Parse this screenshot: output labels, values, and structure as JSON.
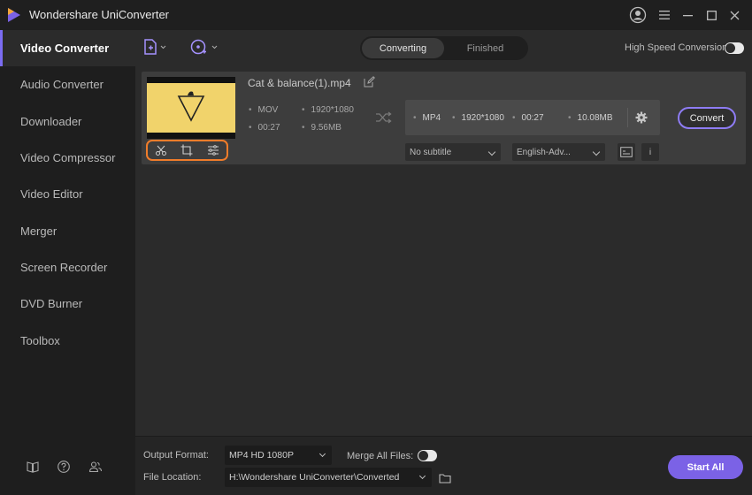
{
  "app": {
    "title": "Wondershare UniConverter",
    "accent_color": "#7b6cf2",
    "highlight_color": "#f07c2a"
  },
  "titlebar": {
    "icons": [
      "account-icon",
      "menu-icon",
      "minimize-icon",
      "maximize-icon",
      "close-icon"
    ]
  },
  "sidebar": {
    "items": [
      {
        "label": "Video Converter",
        "active": true
      },
      {
        "label": "Audio Converter",
        "active": false
      },
      {
        "label": "Downloader",
        "active": false
      },
      {
        "label": "Video Compressor",
        "active": false
      },
      {
        "label": "Video Editor",
        "active": false
      },
      {
        "label": "Merger",
        "active": false
      },
      {
        "label": "Screen Recorder",
        "active": false
      },
      {
        "label": "DVD Burner",
        "active": false
      },
      {
        "label": "Toolbox",
        "active": false
      }
    ],
    "footer_icons": [
      "book-icon",
      "help-icon",
      "users-icon"
    ]
  },
  "toolbar": {
    "tabs": [
      {
        "label": "Converting",
        "active": true
      },
      {
        "label": "Finished",
        "active": false
      }
    ],
    "high_speed_label": "High Speed Conversion",
    "high_speed_enabled": false
  },
  "file": {
    "name": "Cat & balance(1).mp4",
    "source": {
      "format": "MOV",
      "resolution": "1920*1080",
      "duration": "00:27",
      "size": "9.56MB"
    },
    "target": {
      "format": "MP4",
      "resolution": "1920*1080",
      "duration": "00:27",
      "size": "10.08MB"
    },
    "subtitle": "No subtitle",
    "audio": "English-Adv...",
    "convert_label": "Convert",
    "info_label": "i"
  },
  "bottom": {
    "output_format_label": "Output Format:",
    "output_format_value": "MP4 HD 1080P",
    "merge_label": "Merge All Files:",
    "merge_enabled": false,
    "file_location_label": "File Location:",
    "file_location_value": "H:\\Wondershare UniConverter\\Converted",
    "start_all_label": "Start All"
  }
}
